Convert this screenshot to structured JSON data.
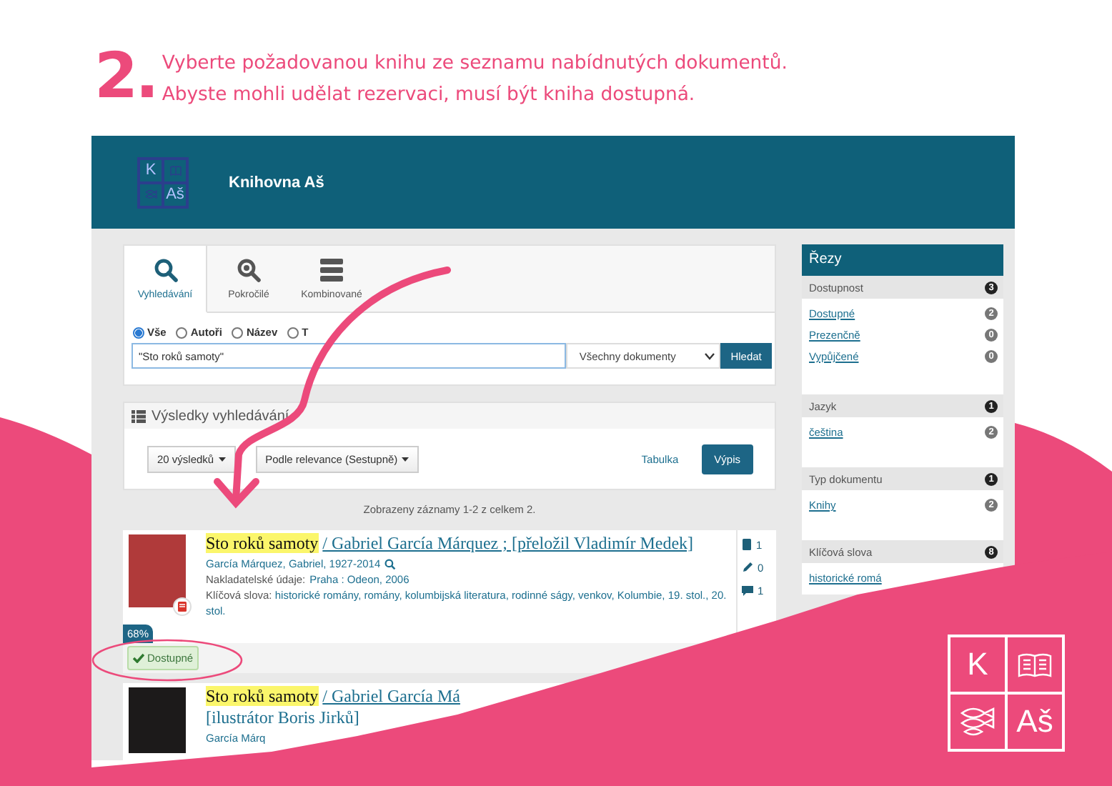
{
  "instruction": {
    "number": "2.",
    "lines": [
      "Vyberte požadovanou knihu ze seznamu nabídnutých dokumentů.",
      "Abyste mohli udělat rezervaci, musí být kniha dostupná."
    ]
  },
  "site": {
    "title": "Knihovna Aš",
    "logo": {
      "top_left": "K",
      "bottom_right": "Aš"
    }
  },
  "search": {
    "tabs": [
      {
        "label": "Vyhledávání",
        "selected": true,
        "kind": "basic"
      },
      {
        "label": "Pokročilé",
        "selected": false,
        "kind": "advanced"
      },
      {
        "label": "Kombinované",
        "selected": false,
        "kind": "combined"
      }
    ],
    "scopes": [
      {
        "label": "Vše",
        "selected": true
      },
      {
        "label": "Autoři",
        "selected": false
      },
      {
        "label": "Název",
        "selected": false
      },
      {
        "label": "T",
        "selected": false
      }
    ],
    "query": "\"Sto roků samoty\"",
    "doc_type": "Všechny dokumenty",
    "button": "Hledat"
  },
  "results": {
    "heading": "Výsledky vyhledávání",
    "page_size": "20 výsledků",
    "sort": "Podle relevance (Sestupně)",
    "views": [
      {
        "label": "Tabulka",
        "selected": false
      },
      {
        "label": "Výpis",
        "selected": true
      }
    ],
    "summary": "Zobrazeny záznamy 1-2 z celkem 2.",
    "records": [
      {
        "title_highlight": "Sto roků samoty",
        "title_rest": "/ Gabriel García Márquez ; [přeložil Vladimír Medek]",
        "author": "García Márquez, Gabriel, 1927-2014",
        "publisher_label": "Nakladatelské údaje:",
        "publisher": "Praha : Odeon, 2006",
        "keywords_label": "Klíčová slova:",
        "keywords": "historické romány, romány, kolumbijská literatura, rodinné ságy, venkov, Kolumbie, 19. stol., 20. stol.",
        "relevance": "68%",
        "availability": "Dostupné",
        "counts": [
          {
            "kind": "copies",
            "value": "1"
          },
          {
            "kind": "reviews",
            "value": "0"
          },
          {
            "kind": "comments",
            "value": "1"
          }
        ]
      },
      {
        "title_highlight": "Sto roků samoty",
        "title_rest": "/ Gabriel García Má",
        "title_line2": "[ilustrátor Boris Jirků]",
        "author": "García Márq"
      }
    ]
  },
  "facets": {
    "title": "Řezy",
    "groups": [
      {
        "title": "Dostupnost",
        "count": "3",
        "items": [
          {
            "label": "Dostupné",
            "count": "2"
          },
          {
            "label": "Prezenčně",
            "count": "0"
          },
          {
            "label": "Vypůjčené",
            "count": "0"
          }
        ]
      },
      {
        "title": "Jazyk",
        "count": "1",
        "items": [
          {
            "label": "čeština",
            "count": "2"
          }
        ]
      },
      {
        "title": "Typ dokumentu",
        "count": "1",
        "items": [
          {
            "label": "Knihy",
            "count": "2"
          }
        ]
      },
      {
        "title": "Klíčová slova",
        "count": "8",
        "items": [
          {
            "label": "historické romá"
          }
        ]
      }
    ]
  },
  "corner_logo": {
    "top_left": "K",
    "bottom_right": "Aš"
  }
}
